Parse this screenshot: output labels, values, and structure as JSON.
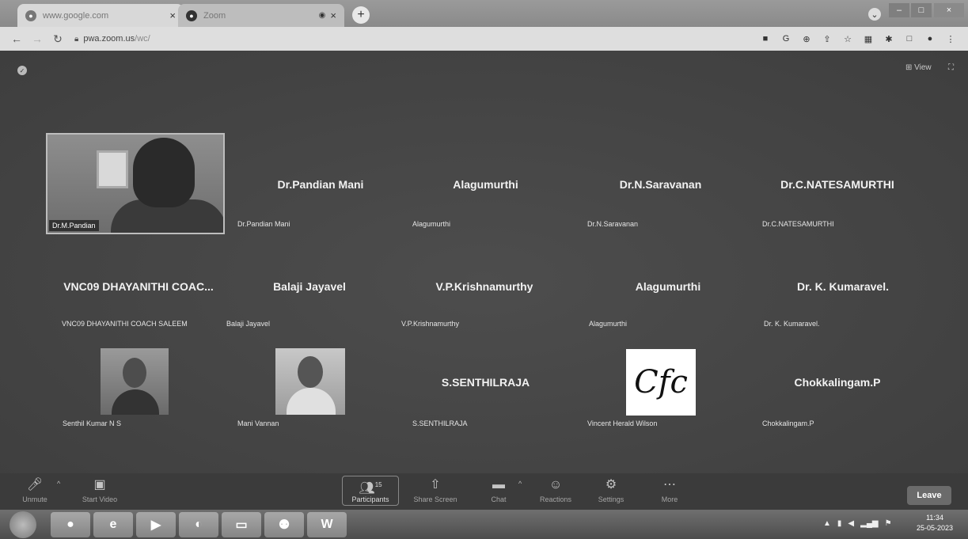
{
  "browser": {
    "tabs": [
      {
        "title": "www.google.com",
        "close": "×"
      },
      {
        "title": "Zoom",
        "close": "×"
      }
    ],
    "new_tab": "+",
    "url_host": "pwa.zoom.us",
    "url_path": "/wc/",
    "window_controls": [
      "⌄",
      "–",
      "□",
      "×"
    ]
  },
  "meeting": {
    "view_label": "⊞ View",
    "participants": [
      {
        "display": "",
        "label": "Dr.M.Pandian",
        "type": "video"
      },
      {
        "display": "Dr.Pandian Mani",
        "label": "Dr.Pandian Mani",
        "type": "name"
      },
      {
        "display": "Alagumurthi",
        "label": "Alagumurthi",
        "type": "name"
      },
      {
        "display": "Dr.N.Saravanan",
        "label": "Dr.N.Saravanan",
        "type": "name"
      },
      {
        "display": "Dr.C.NATESAMURTHI",
        "label": "Dr.C.NATESAMURTHI",
        "type": "name"
      },
      {
        "display": "VNC09 DHAYANITHI COAC...",
        "label": "VNC09 DHAYANITHI COACH SALEEM",
        "type": "name"
      },
      {
        "display": "Balaji Jayavel",
        "label": "Balaji Jayavel",
        "type": "name"
      },
      {
        "display": "V.P.Krishnamurthy",
        "label": "V.P.Krishnamurthy",
        "type": "name"
      },
      {
        "display": "Alagumurthi",
        "label": "Alagumurthi",
        "type": "name"
      },
      {
        "display": "Dr. K. Kumaravel.",
        "label": "Dr. K. Kumaravel.",
        "type": "name"
      },
      {
        "display": "",
        "label": "Senthil Kumar N S",
        "type": "photo"
      },
      {
        "display": "",
        "label": "Mani Vannan",
        "type": "photo"
      },
      {
        "display": "S.SENTHILRAJA",
        "label": "S.SENTHILRAJA",
        "type": "name"
      },
      {
        "display": "Cfc",
        "label": "Vincent Herald Wilson",
        "type": "logo"
      },
      {
        "display": "Chokkalingam.P",
        "label": "Chokkalingam.P",
        "type": "name"
      }
    ]
  },
  "toolbar": {
    "unmute": "Unmute",
    "start_video": "Start Video",
    "participants": "Participants",
    "participants_count": "15",
    "share_screen": "Share Screen",
    "chat": "Chat",
    "reactions": "Reactions",
    "settings": "Settings",
    "more": "More",
    "leave": "Leave"
  },
  "taskbar": {
    "time": "11:34",
    "date": "25-05-2023"
  }
}
